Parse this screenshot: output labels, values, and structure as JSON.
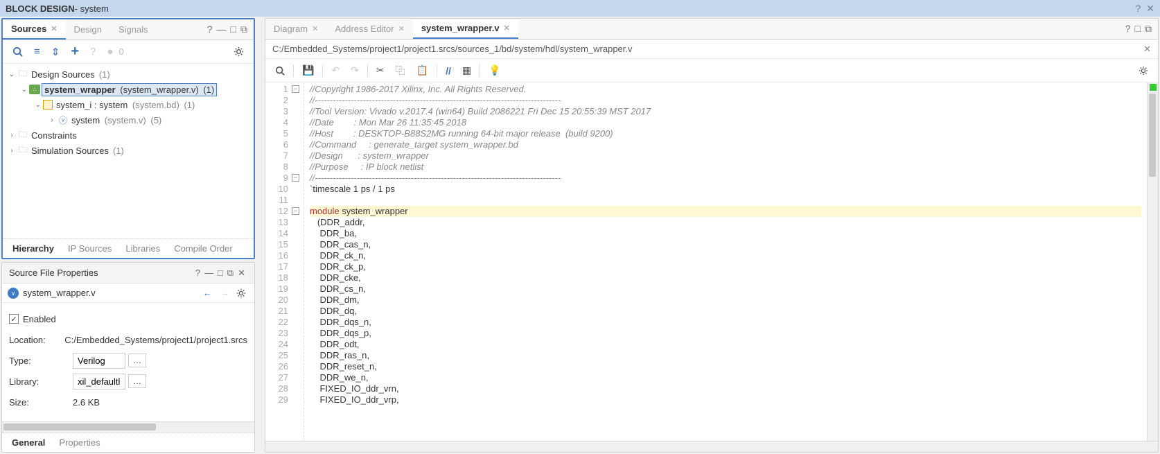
{
  "titlebar": {
    "prefix": "BLOCK DESIGN",
    "suffix": " - system"
  },
  "sources": {
    "tab_sources": "Sources",
    "tab_design": "Design",
    "tab_signals": "Signals",
    "count0": "0",
    "tree": {
      "design_sources": "Design Sources",
      "design_sources_count": "(1)",
      "system_wrapper": "system_wrapper",
      "system_wrapper_file": "(system_wrapper.v)",
      "system_wrapper_count": "(1)",
      "system_i": "system_i : system",
      "system_i_file": "(system.bd)",
      "system_i_count": "(1)",
      "system": "system",
      "system_file": "(system.v)",
      "system_count": "(5)",
      "constraints": "Constraints",
      "sim_sources": "Simulation Sources",
      "sim_sources_count": "(1)"
    },
    "bot_tabs": {
      "hierarchy": "Hierarchy",
      "ip_sources": "IP Sources",
      "libraries": "Libraries",
      "compile_order": "Compile Order"
    }
  },
  "props": {
    "title": "Source File Properties",
    "filename": "system_wrapper.v",
    "enabled": "Enabled",
    "location_label": "Location:",
    "location_val": "C:/Embedded_Systems/project1/project1.srcs",
    "type_label": "Type:",
    "type_val": "Verilog",
    "library_label": "Library:",
    "library_val": "xil_defaultlib",
    "size_label": "Size:",
    "size_val": "2.6 KB",
    "tab_general": "General",
    "tab_properties": "Properties"
  },
  "editor": {
    "tab_diagram": "Diagram",
    "tab_address": "Address Editor",
    "tab_file": "system_wrapper.v",
    "path": "C:/Embedded_Systems/project1/project1.srcs/sources_1/bd/system/hdl/system_wrapper.v",
    "lines": [
      "//Copyright 1986-2017 Xilinx, Inc. All Rights Reserved.",
      "//----------------------------------------------------------------------------------",
      "//Tool Version: Vivado v.2017.4 (win64) Build 2086221 Fri Dec 15 20:55:39 MST 2017",
      "//Date        : Mon Mar 26 11:35:45 2018",
      "//Host        : DESKTOP-B88S2MG running 64-bit major release  (build 9200)",
      "//Command     : generate_target system_wrapper.bd",
      "//Design      : system_wrapper",
      "//Purpose     : IP block netlist",
      "//----------------------------------------------------------------------------------",
      "`timescale 1 ps / 1 ps",
      "",
      "module system_wrapper",
      "   (DDR_addr,",
      "    DDR_ba,",
      "    DDR_cas_n,",
      "    DDR_ck_n,",
      "    DDR_ck_p,",
      "    DDR_cke,",
      "    DDR_cs_n,",
      "    DDR_dm,",
      "    DDR_dq,",
      "    DDR_dqs_n,",
      "    DDR_dqs_p,",
      "    DDR_odt,",
      "    DDR_ras_n,",
      "    DDR_reset_n,",
      "    DDR_we_n,",
      "    FIXED_IO_ddr_vrn,",
      "    FIXED_IO_ddr_vrp,"
    ]
  }
}
